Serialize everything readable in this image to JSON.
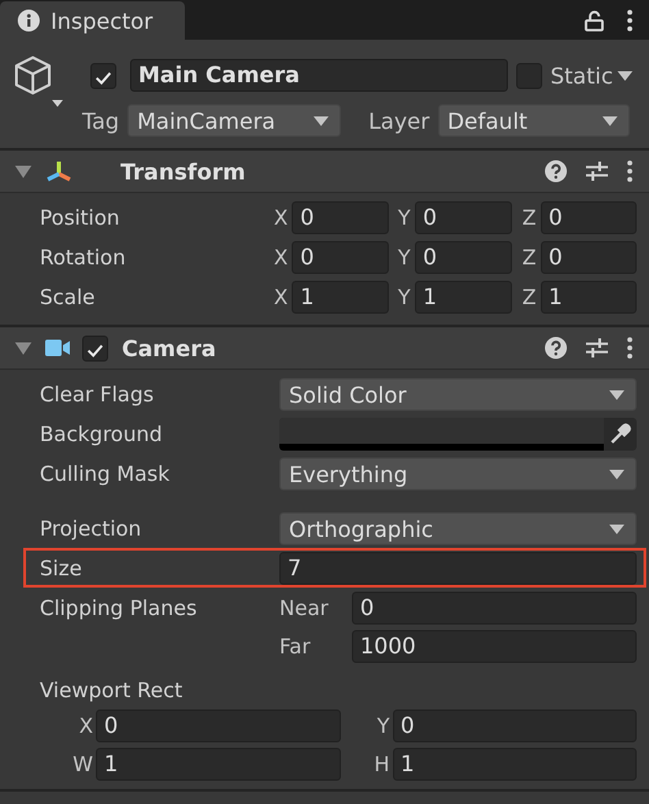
{
  "tab": {
    "title": "Inspector",
    "selected": true
  },
  "game_object": {
    "active": true,
    "name": "Main Camera",
    "static": false,
    "static_label": "Static",
    "tag_label": "Tag",
    "tag": "MainCamera",
    "layer_label": "Layer",
    "layer": "Default"
  },
  "components": [
    {
      "kind": "transform",
      "title": "Transform",
      "expanded": true,
      "groups": [
        {
          "rows": [
            {
              "kind": "vector3",
              "label": "Position",
              "fields": [
                {
                  "axis": "X",
                  "value": "0"
                },
                {
                  "axis": "Y",
                  "value": "0"
                },
                {
                  "axis": "Z",
                  "value": "0"
                }
              ]
            },
            {
              "kind": "vector3",
              "label": "Rotation",
              "fields": [
                {
                  "axis": "X",
                  "value": "0"
                },
                {
                  "axis": "Y",
                  "value": "0"
                },
                {
                  "axis": "Z",
                  "value": "0"
                }
              ]
            },
            {
              "kind": "vector3",
              "label": "Scale",
              "fields": [
                {
                  "axis": "X",
                  "value": "1"
                },
                {
                  "axis": "Y",
                  "value": "1"
                },
                {
                  "axis": "Z",
                  "value": "1"
                }
              ]
            }
          ]
        }
      ]
    },
    {
      "kind": "camera",
      "title": "Camera",
      "expanded": true,
      "enabled": true,
      "groups": [
        {
          "rows": [
            {
              "kind": "dropdown",
              "label": "Clear Flags",
              "value": "Solid Color"
            },
            {
              "kind": "color",
              "label": "Background",
              "color": "#313131"
            },
            {
              "kind": "dropdown",
              "label": "Culling Mask",
              "value": "Everything"
            }
          ]
        },
        {
          "rows": [
            {
              "kind": "dropdown",
              "label": "Projection",
              "value": "Orthographic"
            },
            {
              "kind": "number",
              "label": "Size",
              "value": "7",
              "highlighted": true
            },
            {
              "kind": "near_far",
              "label": "Clipping Planes",
              "fields": [
                {
                  "axis": "Near",
                  "value": "0"
                },
                {
                  "axis": "Far",
                  "value": "1000"
                }
              ]
            },
            {
              "kind": "rect",
              "label": "Viewport Rect",
              "fields": [
                {
                  "axis": "X",
                  "value": "0"
                },
                {
                  "axis": "Y",
                  "value": "0"
                },
                {
                  "axis": "W",
                  "value": "1"
                },
                {
                  "axis": "H",
                  "value": "1"
                }
              ]
            }
          ]
        }
      ]
    }
  ]
}
